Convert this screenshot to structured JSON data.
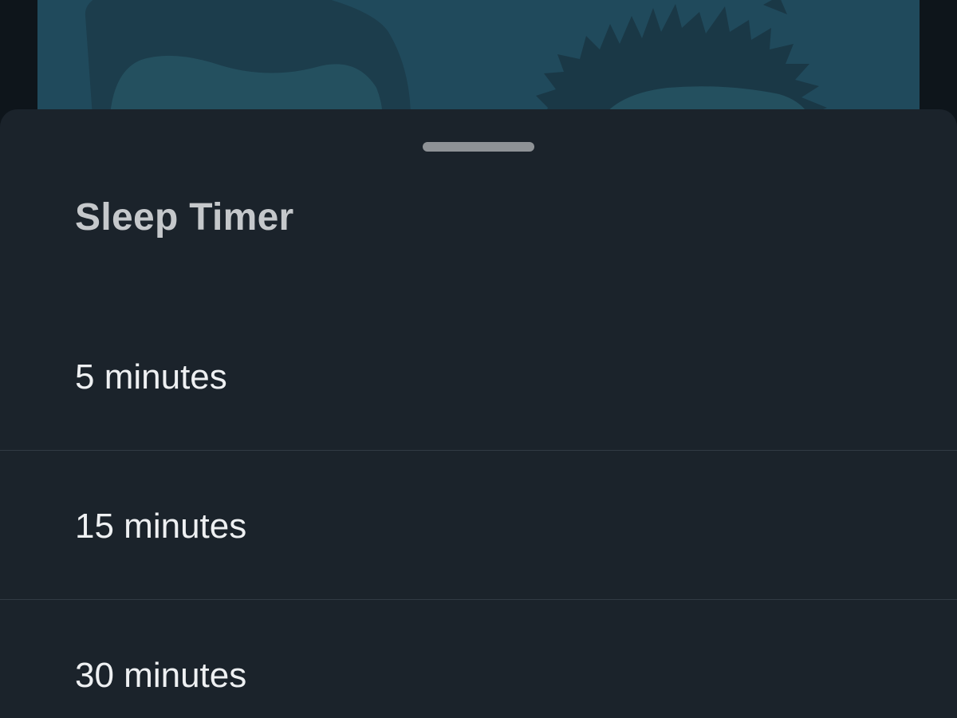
{
  "colors": {
    "background": "#0e151b",
    "artwork": "#204a5c",
    "sheet": "#1b232b",
    "title_text": "#c5c8cb",
    "option_text": "#eef0f2",
    "divider": "#323b44",
    "handle": "#8e9296"
  },
  "artwork": {
    "icon": "cartoon-illustration"
  },
  "sheet": {
    "title": "Sleep Timer",
    "options": [
      {
        "label": "5 minutes"
      },
      {
        "label": "15 minutes"
      },
      {
        "label": "30 minutes"
      }
    ]
  }
}
